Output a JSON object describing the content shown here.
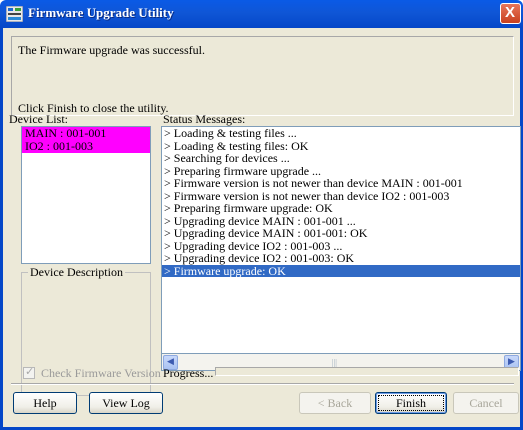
{
  "window": {
    "title": "Firmware Upgrade Utility",
    "close_glyph": "X"
  },
  "message": {
    "line1": "The Firmware upgrade was successful.",
    "line2": "Click Finish to close the utility."
  },
  "device_list": {
    "label": "Device List:",
    "items": [
      "MAIN : 001-001",
      "IO2 : 001-003"
    ],
    "highlight_color": "#ff00ff"
  },
  "device_description": {
    "label": "Device Description"
  },
  "status": {
    "label": "Status Messages:",
    "lines": [
      "> Loading & testing files ...",
      "> Loading & testing files: OK",
      "> Searching for devices ...",
      "> Preparing firmware upgrade ...",
      "> Firmware version is not newer than device MAIN : 001-001",
      "> Firmware version is not newer than device IO2 : 001-003",
      "> Preparing firmware upgrade: OK",
      "> Upgrading device MAIN : 001-001 ...",
      "> Upgrading device MAIN : 001-001: OK",
      "> Upgrading device IO2 : 001-003 ...",
      "> Upgrading device IO2 : 001-003: OK",
      "> Firmware upgrade: OK"
    ],
    "selected_index": 11,
    "selected_color": "#316ac5"
  },
  "options": {
    "check_firmware_label": "Check Firmware Version",
    "check_firmware_checked": true,
    "progress_label": "Progress..."
  },
  "buttons": {
    "help": "Help",
    "view_log": "View Log",
    "back": "< Back",
    "finish": "Finish",
    "cancel": "Cancel"
  },
  "icons": {
    "app": "firmware-app-icon",
    "close": "close-icon",
    "scroll_left": "scroll-left-icon",
    "scroll_right": "scroll-right-icon",
    "check": "check-icon"
  }
}
